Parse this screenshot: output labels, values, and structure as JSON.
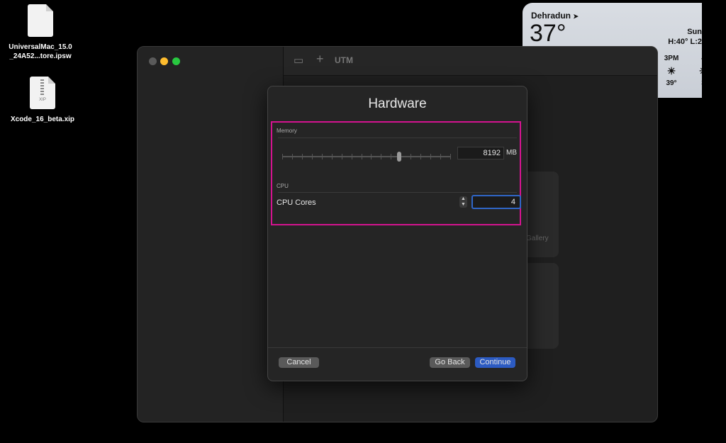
{
  "desktop": {
    "files": [
      {
        "name_line1": "UniversalMac_15.0",
        "name_line2": "_24A52...tore.ipsw",
        "icon": "document-icon"
      },
      {
        "name_line1": "Xcode_16_beta.xip",
        "name_line2": "",
        "icon": "zip-archive-icon",
        "badge": "XIP"
      }
    ]
  },
  "weather": {
    "city": "Dehradun",
    "location_arrow": "➤",
    "temperature": "37°",
    "condition": "Sun",
    "high_low": "H:40° L:2",
    "hours": [
      {
        "time": "3PM",
        "temp": "39°",
        "icon": "sun-icon"
      },
      {
        "time": "4",
        "temp": "3",
        "icon": "sun-icon"
      }
    ]
  },
  "app": {
    "title": "UTM",
    "bg_card_text": "Gallery"
  },
  "dialog": {
    "title": "Hardware",
    "memory_label": "Memory",
    "memory_value": "8192",
    "memory_unit": "MB",
    "memory_slider_fraction": 0.7,
    "cpu_label": "CPU",
    "cpu_cores_label": "CPU Cores",
    "cpu_cores_value": "4",
    "cancel_label": "Cancel",
    "back_label": "Go Back",
    "continue_label": "Continue"
  },
  "colors": {
    "highlight": "#d4138f",
    "accent": "#2c5bc2",
    "close": "#ff5f57",
    "minimize": "#febc2e",
    "zoom": "#28c840"
  }
}
